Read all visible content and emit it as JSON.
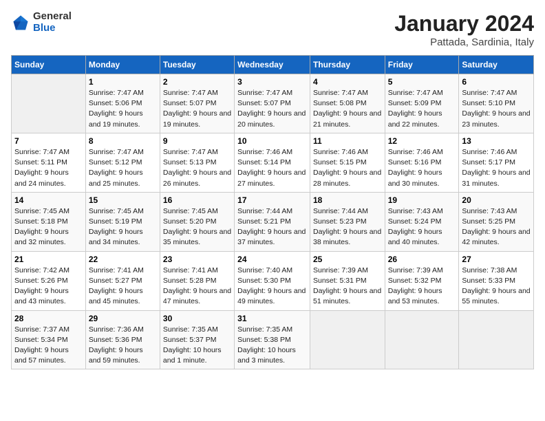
{
  "header": {
    "logo_general": "General",
    "logo_blue": "Blue",
    "month": "January 2024",
    "location": "Pattada, Sardinia, Italy"
  },
  "days_of_week": [
    "Sunday",
    "Monday",
    "Tuesday",
    "Wednesday",
    "Thursday",
    "Friday",
    "Saturday"
  ],
  "weeks": [
    [
      {
        "day": "",
        "sunrise": "",
        "sunset": "",
        "daylight": ""
      },
      {
        "day": "1",
        "sunrise": "Sunrise: 7:47 AM",
        "sunset": "Sunset: 5:06 PM",
        "daylight": "Daylight: 9 hours and 19 minutes."
      },
      {
        "day": "2",
        "sunrise": "Sunrise: 7:47 AM",
        "sunset": "Sunset: 5:07 PM",
        "daylight": "Daylight: 9 hours and 19 minutes."
      },
      {
        "day": "3",
        "sunrise": "Sunrise: 7:47 AM",
        "sunset": "Sunset: 5:07 PM",
        "daylight": "Daylight: 9 hours and 20 minutes."
      },
      {
        "day": "4",
        "sunrise": "Sunrise: 7:47 AM",
        "sunset": "Sunset: 5:08 PM",
        "daylight": "Daylight: 9 hours and 21 minutes."
      },
      {
        "day": "5",
        "sunrise": "Sunrise: 7:47 AM",
        "sunset": "Sunset: 5:09 PM",
        "daylight": "Daylight: 9 hours and 22 minutes."
      },
      {
        "day": "6",
        "sunrise": "Sunrise: 7:47 AM",
        "sunset": "Sunset: 5:10 PM",
        "daylight": "Daylight: 9 hours and 23 minutes."
      }
    ],
    [
      {
        "day": "7",
        "sunrise": "Sunrise: 7:47 AM",
        "sunset": "Sunset: 5:11 PM",
        "daylight": "Daylight: 9 hours and 24 minutes."
      },
      {
        "day": "8",
        "sunrise": "Sunrise: 7:47 AM",
        "sunset": "Sunset: 5:12 PM",
        "daylight": "Daylight: 9 hours and 25 minutes."
      },
      {
        "day": "9",
        "sunrise": "Sunrise: 7:47 AM",
        "sunset": "Sunset: 5:13 PM",
        "daylight": "Daylight: 9 hours and 26 minutes."
      },
      {
        "day": "10",
        "sunrise": "Sunrise: 7:46 AM",
        "sunset": "Sunset: 5:14 PM",
        "daylight": "Daylight: 9 hours and 27 minutes."
      },
      {
        "day": "11",
        "sunrise": "Sunrise: 7:46 AM",
        "sunset": "Sunset: 5:15 PM",
        "daylight": "Daylight: 9 hours and 28 minutes."
      },
      {
        "day": "12",
        "sunrise": "Sunrise: 7:46 AM",
        "sunset": "Sunset: 5:16 PM",
        "daylight": "Daylight: 9 hours and 30 minutes."
      },
      {
        "day": "13",
        "sunrise": "Sunrise: 7:46 AM",
        "sunset": "Sunset: 5:17 PM",
        "daylight": "Daylight: 9 hours and 31 minutes."
      }
    ],
    [
      {
        "day": "14",
        "sunrise": "Sunrise: 7:45 AM",
        "sunset": "Sunset: 5:18 PM",
        "daylight": "Daylight: 9 hours and 32 minutes."
      },
      {
        "day": "15",
        "sunrise": "Sunrise: 7:45 AM",
        "sunset": "Sunset: 5:19 PM",
        "daylight": "Daylight: 9 hours and 34 minutes."
      },
      {
        "day": "16",
        "sunrise": "Sunrise: 7:45 AM",
        "sunset": "Sunset: 5:20 PM",
        "daylight": "Daylight: 9 hours and 35 minutes."
      },
      {
        "day": "17",
        "sunrise": "Sunrise: 7:44 AM",
        "sunset": "Sunset: 5:21 PM",
        "daylight": "Daylight: 9 hours and 37 minutes."
      },
      {
        "day": "18",
        "sunrise": "Sunrise: 7:44 AM",
        "sunset": "Sunset: 5:23 PM",
        "daylight": "Daylight: 9 hours and 38 minutes."
      },
      {
        "day": "19",
        "sunrise": "Sunrise: 7:43 AM",
        "sunset": "Sunset: 5:24 PM",
        "daylight": "Daylight: 9 hours and 40 minutes."
      },
      {
        "day": "20",
        "sunrise": "Sunrise: 7:43 AM",
        "sunset": "Sunset: 5:25 PM",
        "daylight": "Daylight: 9 hours and 42 minutes."
      }
    ],
    [
      {
        "day": "21",
        "sunrise": "Sunrise: 7:42 AM",
        "sunset": "Sunset: 5:26 PM",
        "daylight": "Daylight: 9 hours and 43 minutes."
      },
      {
        "day": "22",
        "sunrise": "Sunrise: 7:41 AM",
        "sunset": "Sunset: 5:27 PM",
        "daylight": "Daylight: 9 hours and 45 minutes."
      },
      {
        "day": "23",
        "sunrise": "Sunrise: 7:41 AM",
        "sunset": "Sunset: 5:28 PM",
        "daylight": "Daylight: 9 hours and 47 minutes."
      },
      {
        "day": "24",
        "sunrise": "Sunrise: 7:40 AM",
        "sunset": "Sunset: 5:30 PM",
        "daylight": "Daylight: 9 hours and 49 minutes."
      },
      {
        "day": "25",
        "sunrise": "Sunrise: 7:39 AM",
        "sunset": "Sunset: 5:31 PM",
        "daylight": "Daylight: 9 hours and 51 minutes."
      },
      {
        "day": "26",
        "sunrise": "Sunrise: 7:39 AM",
        "sunset": "Sunset: 5:32 PM",
        "daylight": "Daylight: 9 hours and 53 minutes."
      },
      {
        "day": "27",
        "sunrise": "Sunrise: 7:38 AM",
        "sunset": "Sunset: 5:33 PM",
        "daylight": "Daylight: 9 hours and 55 minutes."
      }
    ],
    [
      {
        "day": "28",
        "sunrise": "Sunrise: 7:37 AM",
        "sunset": "Sunset: 5:34 PM",
        "daylight": "Daylight: 9 hours and 57 minutes."
      },
      {
        "day": "29",
        "sunrise": "Sunrise: 7:36 AM",
        "sunset": "Sunset: 5:36 PM",
        "daylight": "Daylight: 9 hours and 59 minutes."
      },
      {
        "day": "30",
        "sunrise": "Sunrise: 7:35 AM",
        "sunset": "Sunset: 5:37 PM",
        "daylight": "Daylight: 10 hours and 1 minute."
      },
      {
        "day": "31",
        "sunrise": "Sunrise: 7:35 AM",
        "sunset": "Sunset: 5:38 PM",
        "daylight": "Daylight: 10 hours and 3 minutes."
      },
      {
        "day": "",
        "sunrise": "",
        "sunset": "",
        "daylight": ""
      },
      {
        "day": "",
        "sunrise": "",
        "sunset": "",
        "daylight": ""
      },
      {
        "day": "",
        "sunrise": "",
        "sunset": "",
        "daylight": ""
      }
    ]
  ]
}
